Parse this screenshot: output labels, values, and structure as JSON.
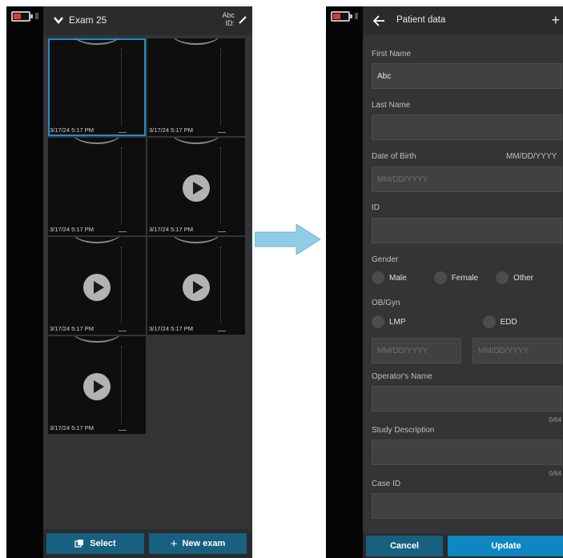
{
  "left_screen": {
    "exam_title": "Exam 25",
    "patient_name": "Abc",
    "patient_id_label": "ID:",
    "thumbnails": [
      {
        "timestamp": "3/17/24 5:17 PM",
        "type": "image",
        "selected": true
      },
      {
        "timestamp": "3/17/24 5:17 PM",
        "type": "image",
        "selected": false
      },
      {
        "timestamp": "3/17/24 5:17 PM",
        "type": "image",
        "selected": false
      },
      {
        "timestamp": "3/17/24 5:17 PM",
        "type": "video",
        "selected": false
      },
      {
        "timestamp": "3/17/24 5:17 PM",
        "type": "video",
        "selected": false
      },
      {
        "timestamp": "3/17/24 5:17 PM",
        "type": "video",
        "selected": false
      },
      {
        "timestamp": "3/17/24 5:17 PM",
        "type": "video",
        "selected": false
      }
    ],
    "select_label": "Select",
    "new_exam_label": "New exam"
  },
  "right_screen": {
    "title": "Patient data",
    "first_name_label": "First Name",
    "first_name_value": "Abc",
    "last_name_label": "Last Name",
    "last_name_value": "",
    "dob_label": "Date of Birth",
    "dob_format_hint": "MM/DD/YYYY",
    "dob_placeholder": "MM/DD/YYYY",
    "id_label": "ID",
    "id_value": "",
    "gender_label": "Gender",
    "gender_options": [
      "Male",
      "Female",
      "Other"
    ],
    "obgyn_label": "OB/Gyn",
    "obgyn_options": [
      "LMP",
      "EDD"
    ],
    "lmp_placeholder": "MM/DD/YYYY",
    "edd_placeholder": "MM/DD/YYYY",
    "operator_label": "Operator's Name",
    "operator_count": "0/64",
    "study_label": "Study Description",
    "study_count": "0/64",
    "case_id_label": "Case ID",
    "cancel_label": "Cancel",
    "update_label": "Update"
  },
  "colors": {
    "accent": "#1d8fc7",
    "button": "#17607f",
    "update_button": "#0f86bf",
    "battery_low": "#e23636",
    "arrow": "#8fcde6"
  }
}
